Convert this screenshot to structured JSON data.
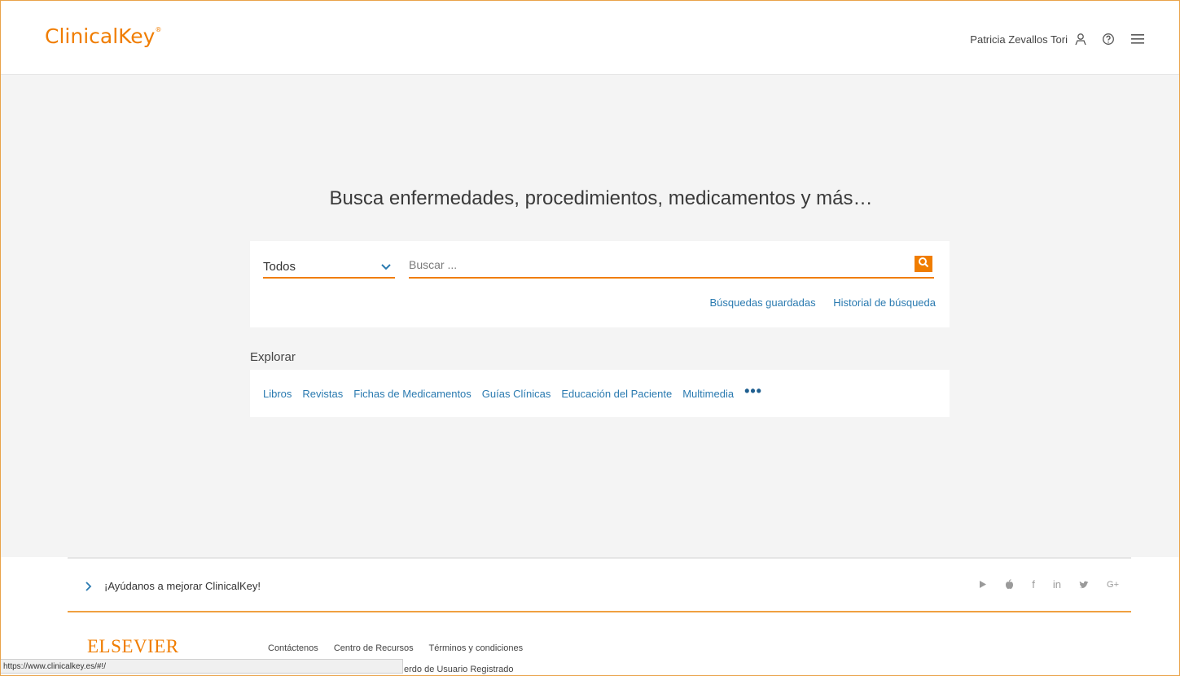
{
  "header": {
    "logo_text": "ClinicalKey",
    "logo_mark": "®",
    "user_name": "Patricia Zevallos Tori",
    "icons": [
      "user-icon",
      "help-icon",
      "menu-icon"
    ]
  },
  "main": {
    "headline": "Busca enfermedades, procedimientos, medicamentos y más…",
    "search": {
      "scope_selected": "Todos",
      "placeholder": "Buscar ...",
      "value": "",
      "links": [
        "Búsquedas guardadas",
        "Historial de búsqueda"
      ]
    },
    "explore": {
      "label": "Explorar",
      "links": [
        "Libros",
        "Revistas",
        "Fichas de Medicamentos",
        "Guías Clínicas",
        "Educación del Paciente",
        "Multimedia"
      ],
      "more": "•••"
    }
  },
  "footer": {
    "feedback_text": "¡Ayúdanos a mejorar ClinicalKey!",
    "social_icons": [
      "google-play-icon",
      "apple-icon",
      "facebook-icon",
      "linkedin-icon",
      "twitter-icon",
      "google-plus-icon"
    ],
    "social_glyphs": [
      "▶",
      "",
      "f",
      "in",
      "🐦",
      "G+"
    ],
    "brand": "ELSEVIER",
    "links": [
      "Contáctenos",
      "Centro de Recursos",
      "Términos y condiciones"
    ],
    "links_row2": "erdo de Usuario Registrado"
  },
  "status_bar": {
    "url": "https://www.clinicalkey.es/#!/"
  },
  "colors": {
    "accent": "#f07d00",
    "link": "#2a7ab0",
    "background": "#f4f4f4"
  }
}
